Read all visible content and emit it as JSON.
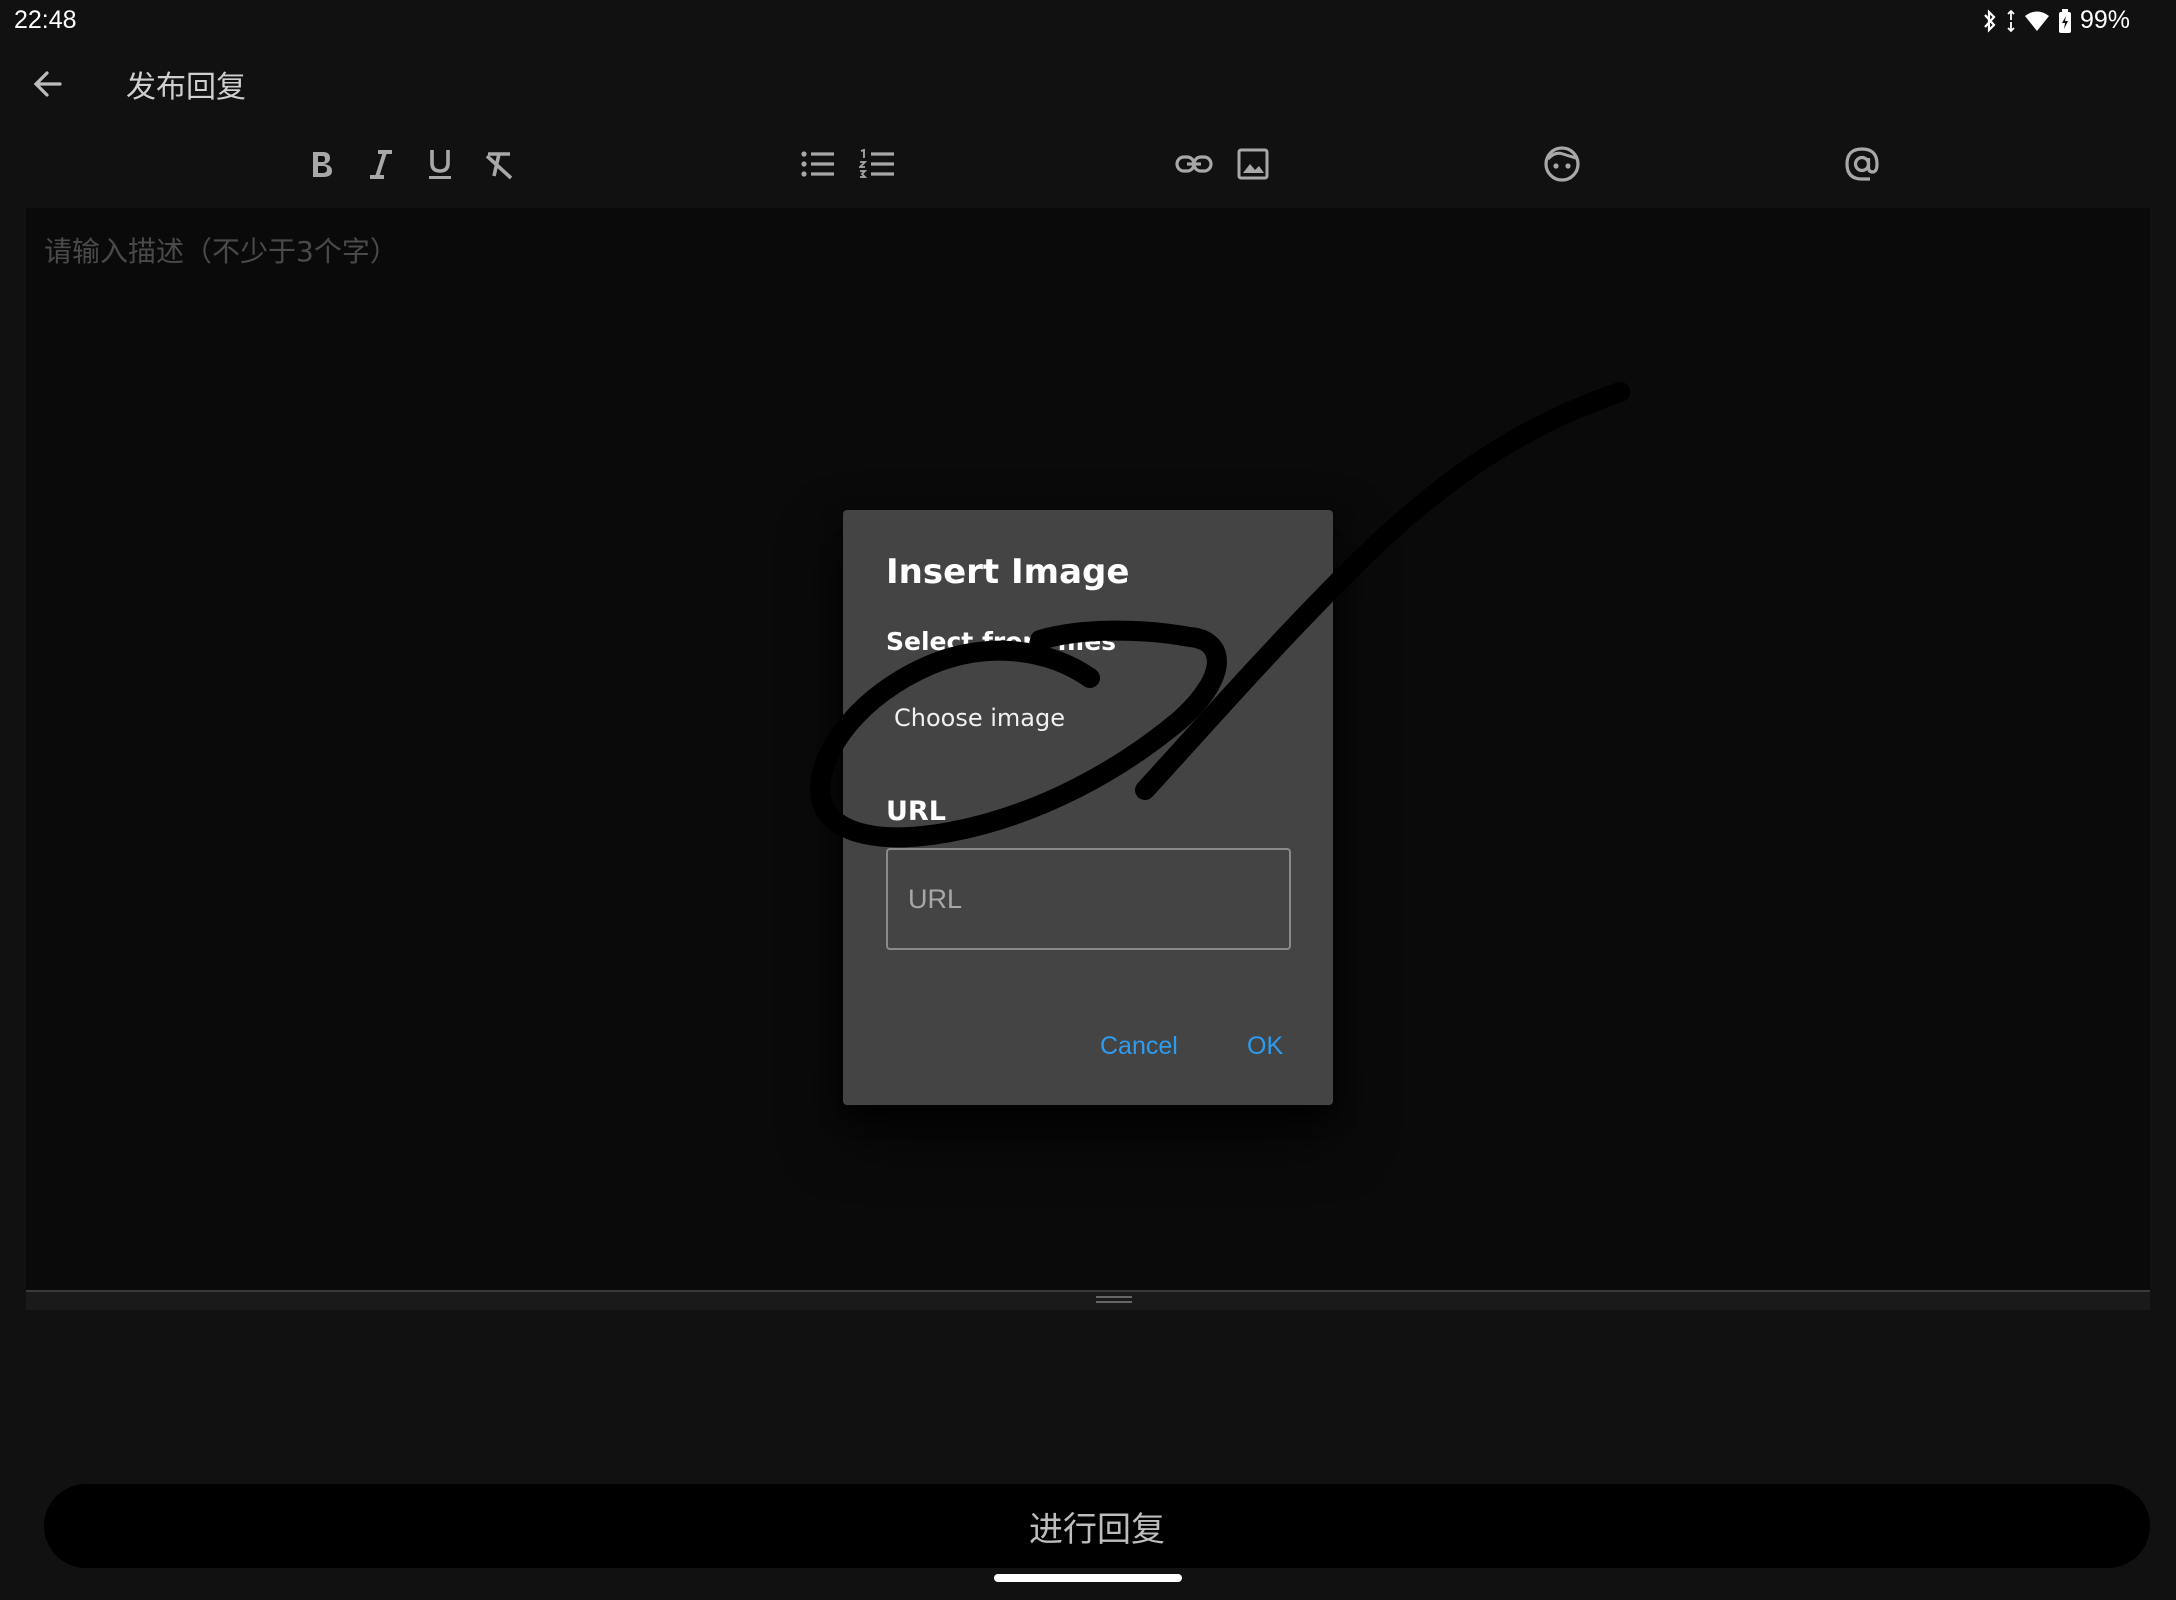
{
  "status_bar": {
    "time": "22:48",
    "battery_percent": "99%",
    "icons": [
      "bluetooth-icon",
      "data-arrows-icon",
      "wifi-icon",
      "battery-icon"
    ]
  },
  "app_bar": {
    "title": "发布回复",
    "back_icon": "arrow-left-icon"
  },
  "toolbar": {
    "tools": [
      "bold",
      "italic",
      "underline",
      "clear-format",
      "bulleted-list",
      "numbered-list",
      "link",
      "image",
      "emoji",
      "mention"
    ]
  },
  "editor": {
    "placeholder": "请输入描述（不少于3个字）"
  },
  "dialog": {
    "title": "Insert Image",
    "select_label": "Select from files",
    "choose_button": "Choose image",
    "url_label": "URL",
    "url_placeholder": "URL",
    "url_value": "",
    "cancel_label": "Cancel",
    "ok_label": "OK"
  },
  "submit": {
    "label": "进行回复"
  },
  "colors": {
    "background": "#111111",
    "editor_background": "#0a0a0a",
    "dialog_background": "#444444",
    "accent": "#2d9cf0",
    "submit_background": "#000000"
  }
}
